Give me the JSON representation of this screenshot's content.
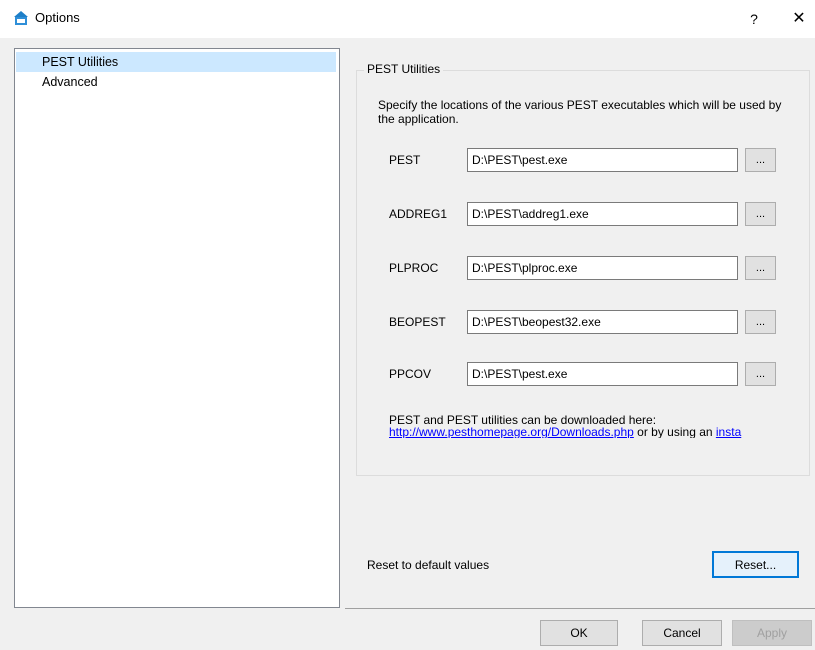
{
  "window": {
    "title": "Options",
    "help_label": "?",
    "close_label": "✕"
  },
  "tree": {
    "items": [
      {
        "label": "PEST Utilities",
        "selected": true
      },
      {
        "label": "Advanced",
        "selected": false
      }
    ]
  },
  "group": {
    "title": "PEST Utilities",
    "description": "Specify the locations of the various PEST executables which will be used by the application.",
    "rows": [
      {
        "label": "PEST",
        "value": "D:\\PEST\\pest.exe",
        "browse": "..."
      },
      {
        "label": "ADDREG1",
        "value": "D:\\PEST\\addreg1.exe",
        "browse": "..."
      },
      {
        "label": "PLPROC",
        "value": "D:\\PEST\\plproc.exe",
        "browse": "..."
      },
      {
        "label": "BEOPEST",
        "value": "D:\\PEST\\beopest32.exe",
        "browse": "..."
      },
      {
        "label": "PPCOV",
        "value": "D:\\PEST\\pest.exe",
        "browse": "..."
      }
    ],
    "download_text": "PEST and PEST utilities can be downloaded here:",
    "download_link": "http://www.pesthomepage.org/Downloads.php",
    "download_middle": " or by using an ",
    "installer_link": "insta"
  },
  "reset": {
    "label": "Reset to default values",
    "button": "Reset..."
  },
  "buttons": {
    "ok": "OK",
    "cancel": "Cancel",
    "apply": "Apply"
  },
  "colors": {
    "selection": "#cce8ff",
    "link": "#0000ff",
    "focus_border": "#0078d7"
  }
}
